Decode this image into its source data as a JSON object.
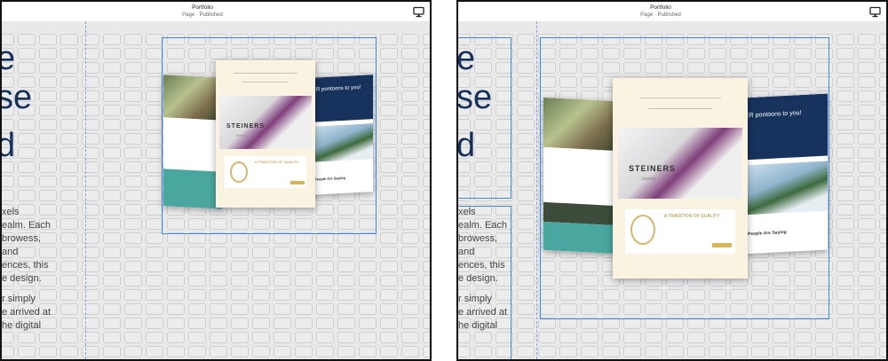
{
  "panes": [
    {
      "header": {
        "title": "Portfolio",
        "subtitle": "Page · Published"
      },
      "device_icon": "desktop-monitor-icon",
      "hero_text_fragments": [
        "e",
        "se",
        "d"
      ],
      "paragraph_fragments": [
        "xels",
        "ealm. Each",
        "browess,",
        "and",
        "ences, this",
        "e design.",
        "r simply",
        "e arrived at",
        "he digital"
      ]
    },
    {
      "header": {
        "title": "Portfolio",
        "subtitle": "Page · Published"
      },
      "device_icon": "desktop-monitor-icon",
      "hero_text_fragments": [
        "e",
        "se",
        "d"
      ],
      "paragraph_fragments": [
        "xels",
        "ealm. Each",
        "browess,",
        "and",
        "ences, this",
        "e design.",
        "r simply",
        "e arrived at",
        "he digital"
      ]
    }
  ],
  "mockups": {
    "center_brand": "STEINERS",
    "center_brand_sub": "Jewelry",
    "center_section": "A TRADITION OF QUALITY",
    "right_banner": "ER pontoons to you!",
    "right_footer": "People Are Saying"
  },
  "colors": {
    "selection": "#3d87e6",
    "hero_text": "#16305c",
    "canvas": "#e9e9ea"
  }
}
